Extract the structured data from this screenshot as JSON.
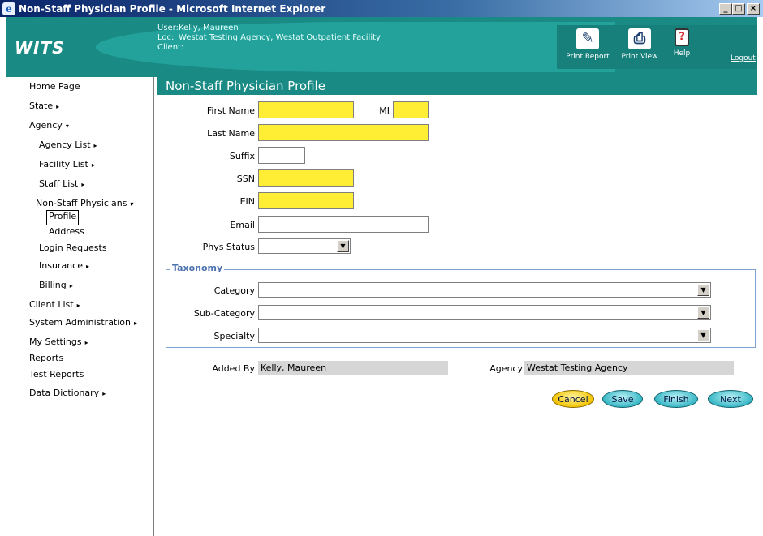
{
  "window": {
    "title": "Non-Staff Physician Profile - Microsoft Internet Explorer",
    "icon": "ie-icon",
    "buttons": {
      "minimize": "_",
      "maximize": "□",
      "close": "×"
    }
  },
  "header": {
    "logo": "WITS",
    "user_label": "User:",
    "user_value": "Kelly, Maureen",
    "loc_label": "Loc:",
    "loc_value": "Westat Testing Agency, Westat Outpatient Facility",
    "client_label": "Client:",
    "client_value": "",
    "tools": {
      "print_report": "Print Report",
      "print_view": "Print View",
      "help": "Help"
    },
    "logout": "Logout"
  },
  "sidebar": {
    "items": [
      {
        "label": "Home Page",
        "arrow": ""
      },
      {
        "label": "State",
        "arrow": "▸"
      },
      {
        "label": "Agency",
        "arrow": "▾"
      },
      {
        "label": "Agency List",
        "arrow": "▸"
      },
      {
        "label": "Facility List",
        "arrow": "▸"
      },
      {
        "label": "Staff List",
        "arrow": "▸"
      },
      {
        "label": "Non-Staff Physicians",
        "arrow": "▾"
      },
      {
        "label": "Profile",
        "arrow": ""
      },
      {
        "label": "Address",
        "arrow": ""
      },
      {
        "label": "Login Requests",
        "arrow": ""
      },
      {
        "label": "Insurance",
        "arrow": "▸"
      },
      {
        "label": "Billing",
        "arrow": "▸"
      },
      {
        "label": "Client List",
        "arrow": "▸"
      },
      {
        "label": "System Administration",
        "arrow": "▸"
      },
      {
        "label": "My Settings",
        "arrow": "▸"
      },
      {
        "label": "Reports",
        "arrow": ""
      },
      {
        "label": "Test Reports",
        "arrow": ""
      },
      {
        "label": "Data Dictionary",
        "arrow": "▸"
      }
    ]
  },
  "form": {
    "title": "Non-Staff Physician Profile",
    "first_name_label": "First Name",
    "first_name_value": "",
    "mi_label": "MI",
    "mi_value": "",
    "last_name_label": "Last Name",
    "last_name_value": "",
    "suffix_label": "Suffix",
    "suffix_value": "",
    "ssn_label": "SSN",
    "ssn_value": "",
    "ein_label": "EIN",
    "ein_value": "",
    "email_label": "Email",
    "email_value": "",
    "phys_status_label": "Phys Status",
    "phys_status_value": "",
    "taxonomy": {
      "legend": "Taxonomy",
      "category_label": "Category",
      "category_value": "",
      "sub_category_label": "Sub-Category",
      "sub_category_value": "",
      "specialty_label": "Specialty",
      "specialty_value": ""
    },
    "added_by_label": "Added By",
    "added_by_value": "Kelly, Maureen",
    "agency_label": "Agency",
    "agency_value": "Westat Testing Agency"
  },
  "actions": {
    "cancel": "Cancel",
    "save": "Save",
    "finish": "Finish",
    "next": "Next"
  },
  "colors": {
    "teal": "#1a8a84",
    "required": "#ffee33",
    "accent_button": "#39b7c6",
    "cancel_button": "#f4c400"
  }
}
